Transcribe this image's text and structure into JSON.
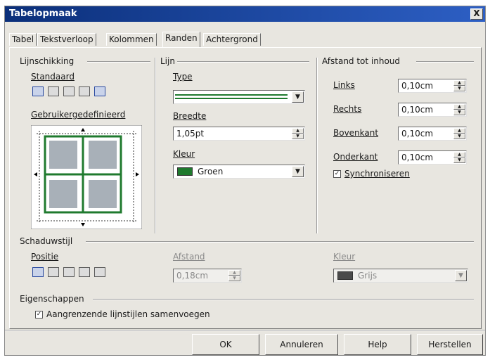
{
  "window": {
    "title": "Tabelopmaak",
    "close_label": "X"
  },
  "tabs": [
    {
      "label": "Tabel"
    },
    {
      "label": "Tekstverloop"
    },
    {
      "label": "Kolommen"
    },
    {
      "label": "Randen",
      "active": true
    },
    {
      "label": "Achtergrond"
    }
  ],
  "lijnschikking": {
    "group_label": "Lijnschikking",
    "standaard_label": "Standaard",
    "custom_label": "Gebruikergedefinieerd"
  },
  "lijn": {
    "group_label": "Lijn",
    "type_label": "Type",
    "breedte_label": "Breedte",
    "breedte_value": "1,05pt",
    "kleur_label": "Kleur",
    "kleur_value": "Groen",
    "kleur_color": "#1f7a2e"
  },
  "afstand": {
    "group_label": "Afstand tot inhoud",
    "rows": [
      {
        "label": "Links",
        "value": "0,10cm"
      },
      {
        "label": "Rechts",
        "value": "0,10cm"
      },
      {
        "label": "Bovenkant",
        "value": "0,10cm"
      },
      {
        "label": "Onderkant",
        "value": "0,10cm"
      }
    ],
    "sync_label": "Synchroniseren",
    "sync_checked": "✓"
  },
  "schaduw": {
    "group_label": "Schaduwstijl",
    "positie_label": "Positie",
    "afstand_label": "Afstand",
    "afstand_value": "0,18cm",
    "kleur_label": "Kleur",
    "kleur_value": "Grijs",
    "kleur_color": "#4a4a4a"
  },
  "eigenschappen": {
    "group_label": "Eigenschappen",
    "merge_label": "Aangrenzende lijnstijlen samenvoegen",
    "merge_checked": "✓"
  },
  "buttons": {
    "ok": "OK",
    "annuleren": "Annuleren",
    "help": "Help",
    "herstellen": "Herstellen"
  },
  "colors": {
    "titlebar": "#0b2f7a",
    "border_line": "#1f7a2e"
  }
}
